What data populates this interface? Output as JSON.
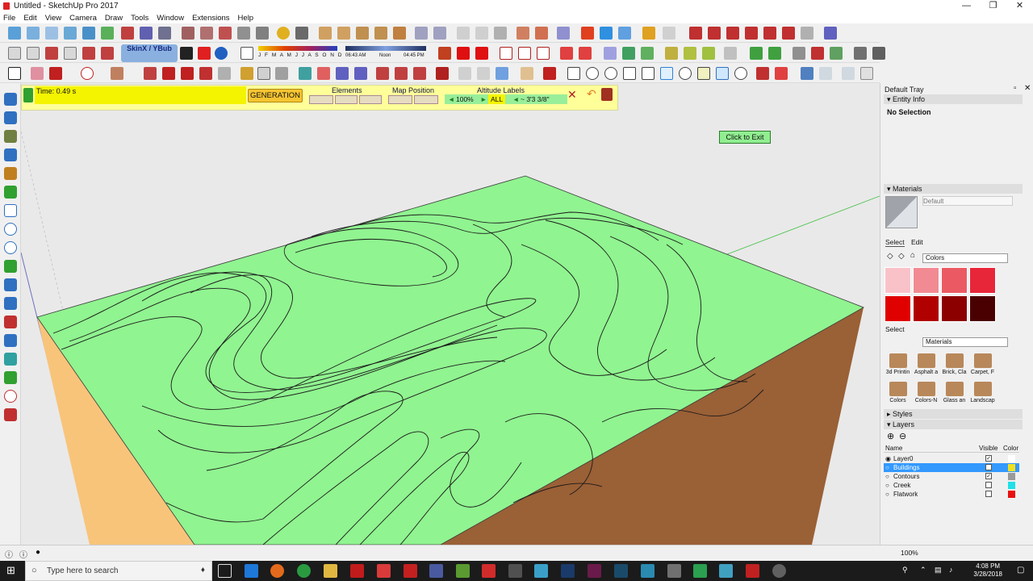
{
  "window": {
    "title": "Untitled - SketchUp Pro 2017",
    "minimize": "—",
    "maximize": "❐",
    "close": "✕"
  },
  "menu": [
    "File",
    "Edit",
    "View",
    "Camera",
    "Draw",
    "Tools",
    "Window",
    "Extensions",
    "Help"
  ],
  "toolbar": {
    "skinxyou_label": "SkinX / YBub",
    "months": "J F M A M J J A S O N D",
    "time_start": "06:43 AM",
    "time_noon": "Noon",
    "time_end": "04:45 PM"
  },
  "plugin": {
    "time_label": "Time: 0.49 s",
    "generation_button": "GENERATION",
    "elements_label": "Elements",
    "map_position_label": "Map Position",
    "altitude_labels_label": "Altitude Labels",
    "zoom_value": "100%",
    "all_label": "ALL",
    "altitude_value": "~ 3'3 3/8\""
  },
  "viewport": {
    "click_to_exit": "Click to Exit"
  },
  "tray": {
    "title": "Default Tray",
    "entity_info": {
      "header": "Entity Info",
      "value": "No Selection"
    },
    "materials": {
      "header": "Materials",
      "name_placeholder": "Default",
      "tab_select": "Select",
      "tab_edit": "Edit",
      "collection": "Colors",
      "swatches": [
        "#f9c2c9",
        "#f28a93",
        "#eb5a63",
        "#e8263a",
        "#e00000",
        "#b00000",
        "#8c0000",
        "#4a0000"
      ],
      "secondary_label": "Select",
      "secondary_collection": "Materials",
      "thumbnails": [
        "3d Printin",
        "Asphalt a",
        "Brick, Cla",
        "Carpet, F",
        "Colors",
        "Colors-N",
        "Glass an",
        "Landscap"
      ]
    },
    "styles": {
      "header": "Styles"
    },
    "layers": {
      "header": "Layers",
      "col_name": "Name",
      "col_visible": "Visible",
      "col_color": "Color",
      "rows": [
        {
          "name": "Layer0",
          "visible": true,
          "color": "#ffffff"
        },
        {
          "name": "Buildings",
          "visible": false,
          "color": "#f0e020"
        },
        {
          "name": "Contours",
          "visible": true,
          "color": "#9a9a9a"
        },
        {
          "name": "Creek",
          "visible": false,
          "color": "#20e0e8"
        },
        {
          "name": "Flatwork",
          "visible": false,
          "color": "#e81010"
        }
      ]
    },
    "zoom": "100%"
  },
  "taskbar": {
    "search_placeholder": "Type here to search",
    "time": "4:08 PM",
    "date": "3/28/2018"
  }
}
